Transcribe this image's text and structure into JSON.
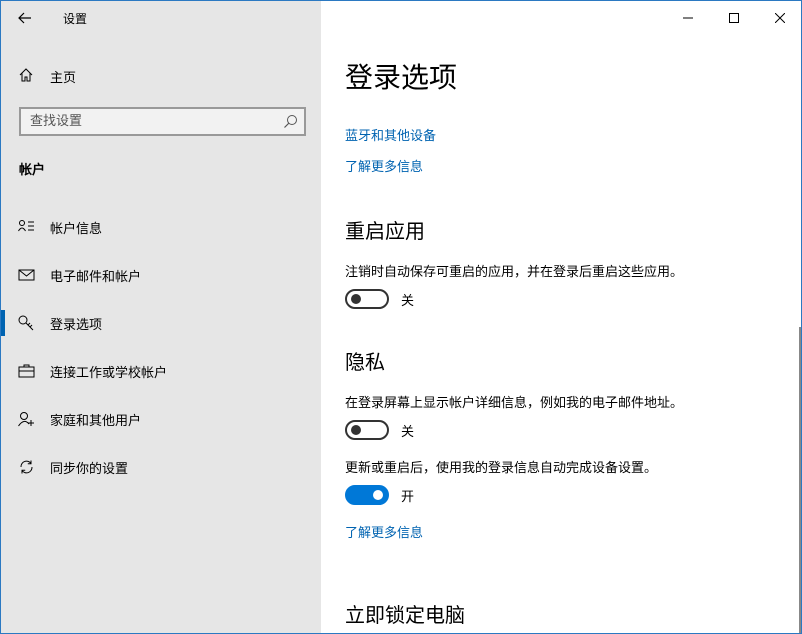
{
  "app": {
    "title": "设置"
  },
  "sidebar": {
    "home_label": "主页",
    "search_placeholder": "查找设置",
    "section_heading": "帐户",
    "items": [
      {
        "label": "帐户信息",
        "icon": "account-info-icon"
      },
      {
        "label": "电子邮件和帐户",
        "icon": "mail-icon"
      },
      {
        "label": "登录选项",
        "icon": "key-icon",
        "active": true
      },
      {
        "label": "连接工作或学校帐户",
        "icon": "briefcase-icon"
      },
      {
        "label": "家庭和其他用户",
        "icon": "add-person-icon"
      },
      {
        "label": "同步你的设置",
        "icon": "sync-icon"
      }
    ]
  },
  "main": {
    "title": "登录选项",
    "link_bluetooth": "蓝牙和其他设备",
    "link_learn_more_1": "了解更多信息",
    "restart_apps": {
      "heading": "重启应用",
      "description": "注销时自动保存可重启的应用，并在登录后重启这些应用。",
      "toggle_state": "关"
    },
    "privacy": {
      "heading": "隐私",
      "description_1": "在登录屏幕上显示帐户详细信息，例如我的电子邮件地址。",
      "toggle_1_state": "关",
      "description_2": "更新或重启后，使用我的登录信息自动完成设备设置。",
      "toggle_2_state": "开",
      "learn_more": "了解更多信息"
    },
    "lock_heading": "立即锁定电脑"
  },
  "colors": {
    "accent": "#0078d7",
    "link": "#0063b1",
    "sidebar_bg": "#e6e6e6"
  }
}
